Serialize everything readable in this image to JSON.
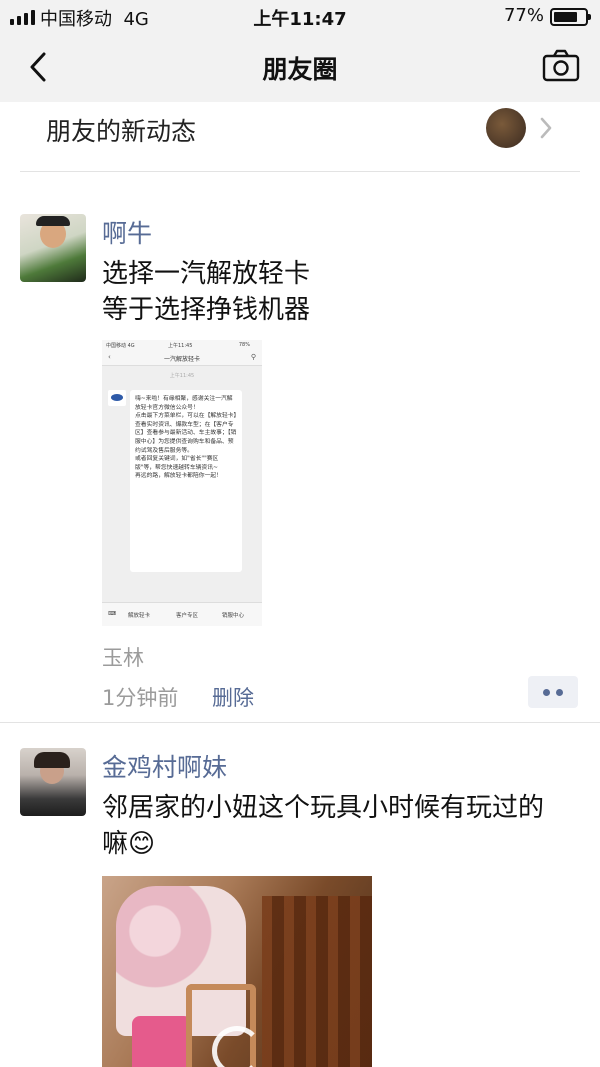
{
  "status_bar": {
    "carrier": "中国移动",
    "network": "4G",
    "time": "上午11:47",
    "battery_pct": "77%",
    "battery_level": 0.77
  },
  "nav": {
    "title": "朋友圈"
  },
  "notify": {
    "label": "朋友的新动态"
  },
  "posts": [
    {
      "name": "啊牛",
      "text_line1": "选择一汽解放轻卡",
      "text_line2": "等于选择挣钱机器",
      "location": "玉林",
      "time": "1分钟前",
      "delete_label": "删除",
      "screenshot": {
        "carrier": "中国移动 4G",
        "time": "上午11:45",
        "battery": "78%",
        "title": "一汽解放轻卡",
        "timestamp": "上午11:45",
        "message": "嗨~来啦！有缘相聚，感谢关注一汽解放轻卡官方微信公众号！\n点击最下方菜单栏，可以在【解放轻卡】查看实时资讯、爆款车型；在【客户专区】查看参与最新活动、车主故事；【销服中心】为您提供查询购车和备品、预约试驾及售后服务等。\n或者回复关键词，如\"省长\"\"赛区版\"等，帮您快速越转车辆资讯~\n再远的路，解放轻卡都陪你一起！",
        "menu": [
          "解放轻卡",
          "客户专区",
          "销服中心"
        ]
      }
    },
    {
      "name": "金鸡村啊妹",
      "text_line1": "邻居家的小妞这个玩具小时候有玩过的",
      "text_line2": "嘛😊"
    }
  ]
}
